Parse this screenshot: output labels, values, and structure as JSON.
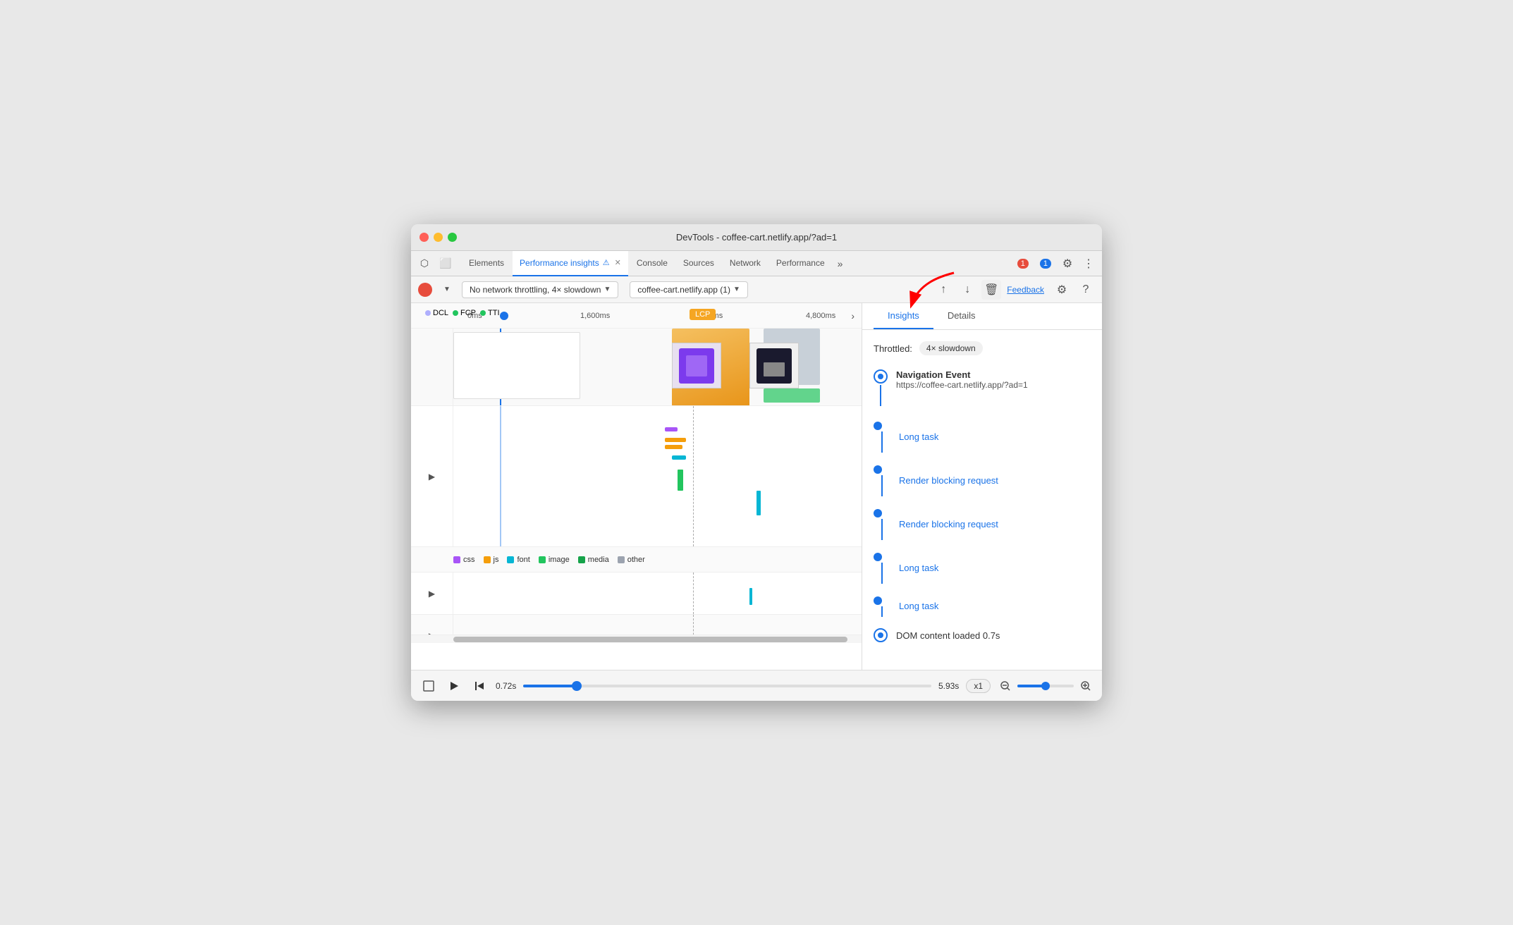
{
  "window": {
    "title": "DevTools - coffee-cart.netlify.app/?ad=1"
  },
  "tabs": {
    "items": [
      {
        "label": "Elements",
        "active": false,
        "closeable": false
      },
      {
        "label": "Performance insights",
        "active": true,
        "closeable": true
      },
      {
        "label": "Console",
        "active": false,
        "closeable": false
      },
      {
        "label": "Sources",
        "active": false,
        "closeable": false
      },
      {
        "label": "Network",
        "active": false,
        "closeable": false
      },
      {
        "label": "Performance",
        "active": false,
        "closeable": false
      }
    ],
    "more_label": "»",
    "errors_badge": "1",
    "messages_badge": "1"
  },
  "toolbar": {
    "network_throttle": "No network throttling, 4× slowdown",
    "url": "coffee-cart.netlify.app (1)",
    "feedback_label": "Feedback"
  },
  "timeline": {
    "markers": [
      "0ms",
      "1,600ms",
      "3,200ms",
      "4,800ms"
    ],
    "legend": [
      {
        "color": "#a855f7",
        "label": "css"
      },
      {
        "color": "#f59e0b",
        "label": "js"
      },
      {
        "color": "#06b6d4",
        "label": "font"
      },
      {
        "color": "#22c55e",
        "label": "image"
      },
      {
        "color": "#16a34a",
        "label": "media"
      },
      {
        "color": "#9ca3af",
        "label": "other"
      }
    ]
  },
  "insights": {
    "tabs": [
      "Insights",
      "Details"
    ],
    "active_tab": "Insights",
    "throttled_label": "Throttled:",
    "throttled_value": "4× slowdown",
    "events": [
      {
        "type": "navigation",
        "title": "Navigation Event",
        "url": "https://coffee-cart.netlify.app/?ad=1"
      },
      {
        "type": "link",
        "label": "Long task"
      },
      {
        "type": "link",
        "label": "Render blocking request"
      },
      {
        "type": "link",
        "label": "Render blocking request"
      },
      {
        "type": "link",
        "label": "Long task"
      },
      {
        "type": "link",
        "label": "Long task"
      },
      {
        "type": "dom",
        "label": "DOM content loaded 0.7s"
      }
    ]
  },
  "playback": {
    "start_time": "0.72s",
    "end_time": "5.93s",
    "speed": "x1",
    "slider_percent": 13
  },
  "event_labels": {
    "dcl": "DCL",
    "fcp": "FCP",
    "tti": "TTI",
    "lcp": "LCP"
  }
}
